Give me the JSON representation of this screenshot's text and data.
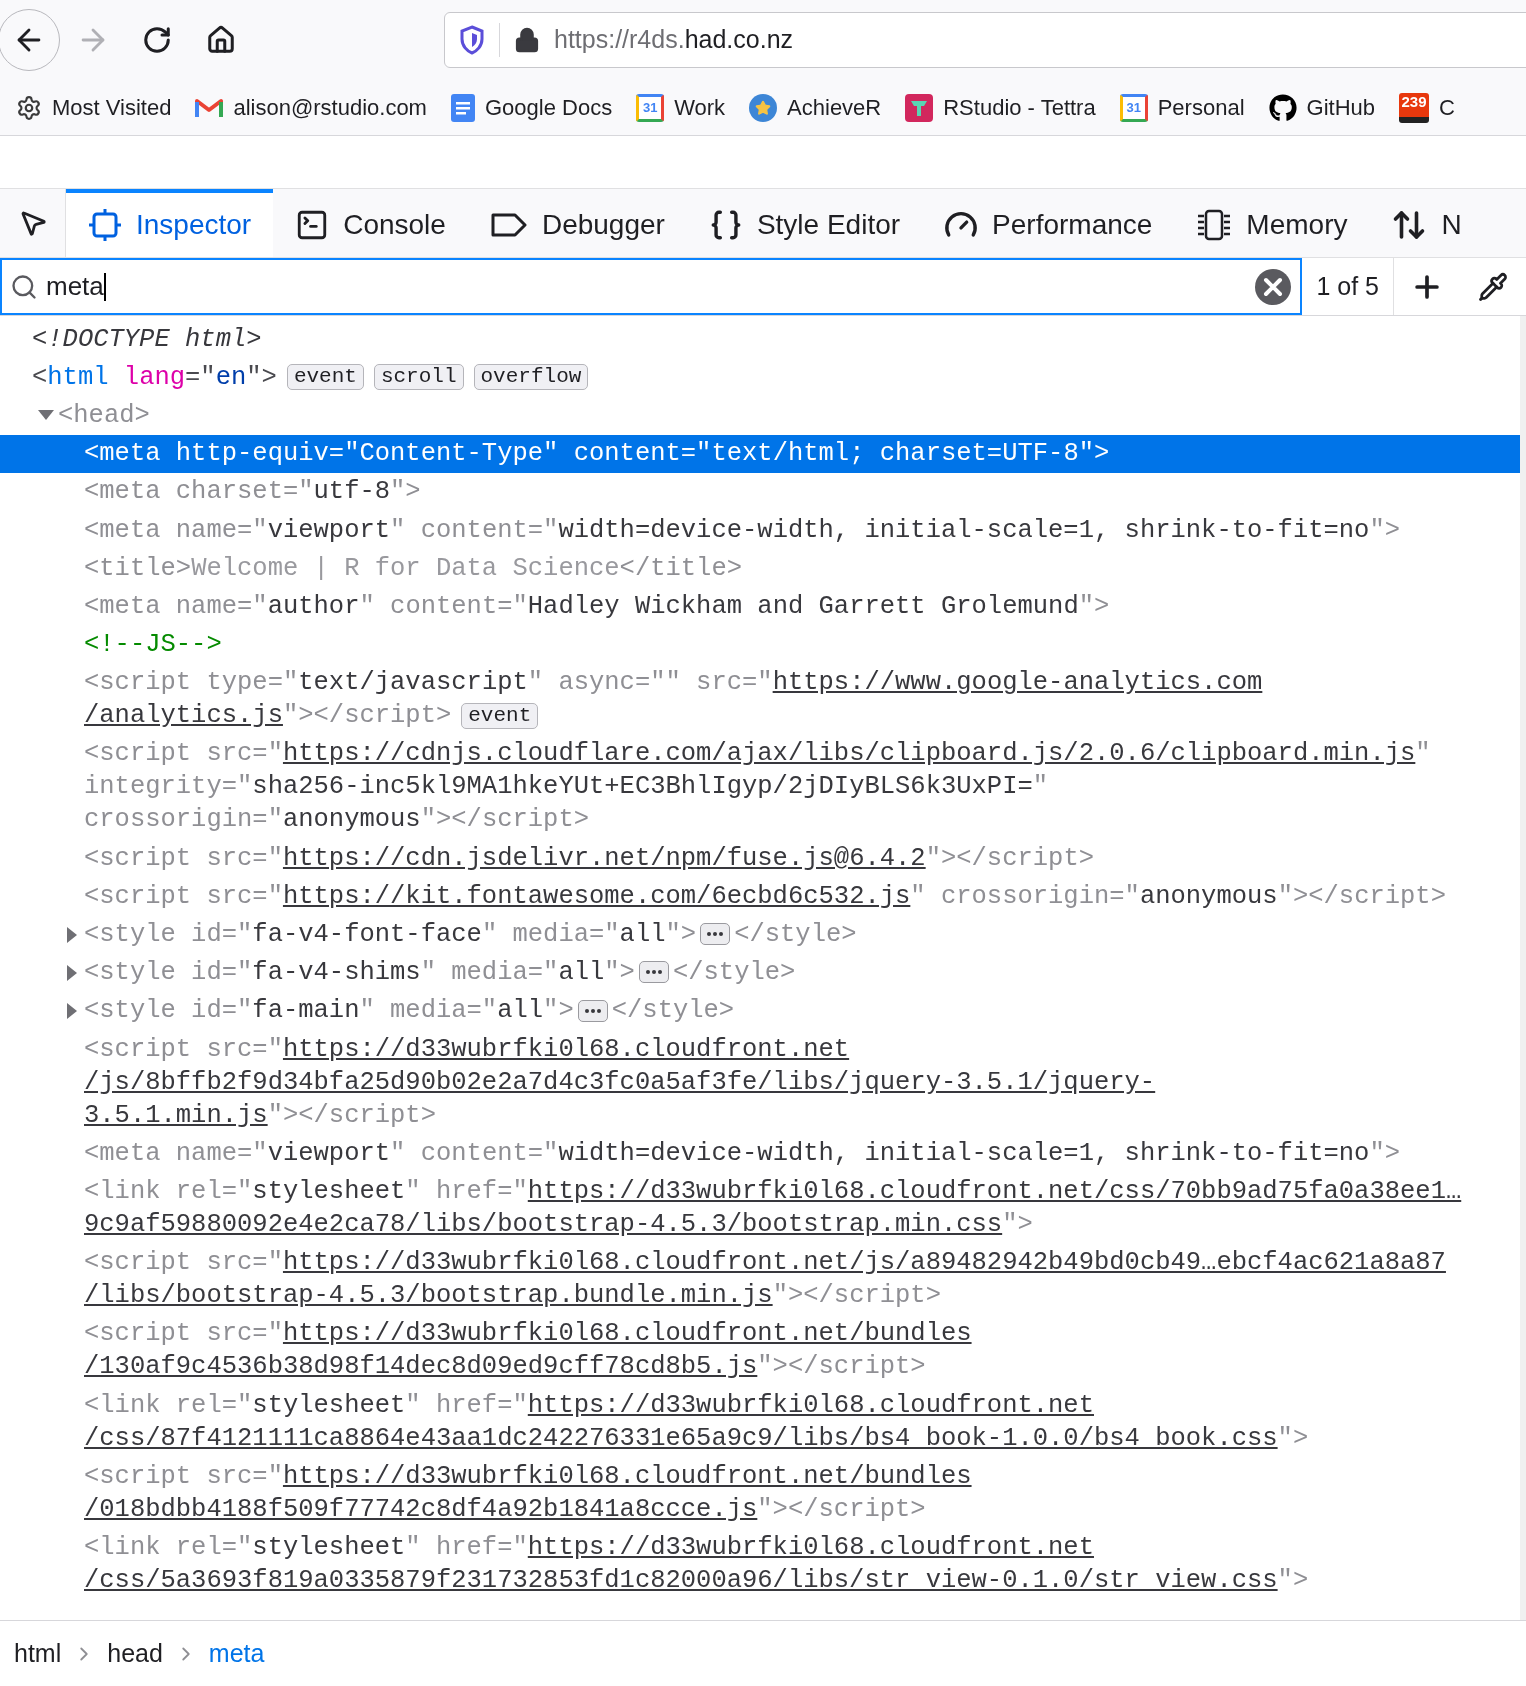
{
  "nav_buttons": [
    {
      "kind": "back",
      "disabled": false
    },
    {
      "kind": "forward",
      "disabled": true
    },
    {
      "kind": "reload",
      "disabled": false
    },
    {
      "kind": "home",
      "disabled": false
    }
  ],
  "url": {
    "prefix": "https://r4ds.",
    "host": "had.co.nz"
  },
  "bookmarks": [
    {
      "kind": "gear",
      "label": "Most Visited"
    },
    {
      "kind": "mail",
      "label": "alison@rstudio.com"
    },
    {
      "kind": "docs",
      "label": "Google Docs"
    },
    {
      "kind": "calendar",
      "icon_text": "31",
      "label": "Work"
    },
    {
      "kind": "star",
      "label": "AchieveR"
    },
    {
      "kind": "tettra",
      "label": "RStudio - Tettra"
    },
    {
      "kind": "calendar",
      "icon_text": "31",
      "label": "Personal"
    },
    {
      "kind": "github",
      "label": "GitHub"
    },
    {
      "kind": "counter",
      "icon_text": "239",
      "label": "C"
    }
  ],
  "devtools_tabs": [
    {
      "kind": "inspector",
      "label": "Inspector",
      "selected": true
    },
    {
      "kind": "console",
      "label": "Console",
      "selected": false
    },
    {
      "kind": "debugger",
      "label": "Debugger",
      "selected": false
    },
    {
      "kind": "style",
      "label": "Style Editor",
      "selected": false
    },
    {
      "kind": "performance",
      "label": "Performance",
      "selected": false
    },
    {
      "kind": "memory",
      "label": "Memory",
      "selected": false
    },
    {
      "kind": "network",
      "label": "N",
      "selected": false
    }
  ],
  "search": {
    "value": "meta",
    "match_count": "1 of 5"
  },
  "nodes": [
    {
      "selected": false,
      "lines": [
        [
          {
            "kind": "doctype",
            "text": "<!DOCTYPE html>"
          }
        ]
      ]
    },
    {
      "selected": false,
      "dimmed": false,
      "badges": [
        "event",
        "scroll",
        "overflow"
      ],
      "lines": [
        [
          {
            "kind": "punct",
            "text": "<"
          },
          {
            "kind": "tagname",
            "text": "html"
          },
          {
            "kind": "attr",
            "text": " lang"
          },
          {
            "kind": "punct",
            "text": "=\""
          },
          {
            "kind": "value",
            "text": "en"
          },
          {
            "kind": "punct",
            "text": "\">"
          }
        ]
      ],
      "children": [
        {
          "selected": false,
          "dimmed": true,
          "expanded": true,
          "lines": [
            [
              {
                "kind": "punct",
                "text": "<head>"
              }
            ]
          ],
          "children": [
            {
              "selected": true,
              "lines": [
                [
                  {
                    "kind": "punct",
                    "text": "<meta http-equiv=\""
                  },
                  {
                    "kind": "value",
                    "text": "Content-Type"
                  },
                  {
                    "kind": "punct",
                    "text": "\" content=\""
                  },
                  {
                    "kind": "value",
                    "text": "text/html; charset=UTF-8"
                  },
                  {
                    "kind": "punct",
                    "text": "\">"
                  }
                ]
              ]
            },
            {
              "selected": false,
              "lines": [
                [
                  {
                    "kind": "punct",
                    "text": "<meta charset=\""
                  },
                  {
                    "kind": "value",
                    "text": "utf-8"
                  },
                  {
                    "kind": "punct",
                    "text": "\">"
                  }
                ]
              ]
            },
            {
              "selected": false,
              "lines": [
                [
                  {
                    "kind": "punct",
                    "text": "<meta name=\""
                  },
                  {
                    "kind": "value",
                    "text": "viewport"
                  },
                  {
                    "kind": "punct",
                    "text": "\" content=\""
                  },
                  {
                    "kind": "value",
                    "text": "width=device-width, initial-scale=1, shrink-to-fit=no"
                  },
                  {
                    "kind": "punct",
                    "text": "\">"
                  }
                ]
              ]
            },
            {
              "selected": false,
              "lines": [
                [
                  {
                    "kind": "punct",
                    "text": "<title>"
                  },
                  {
                    "kind": "text",
                    "text": "Welcome | R for Data Science"
                  },
                  {
                    "kind": "punct",
                    "text": "</title>"
                  }
                ]
              ]
            },
            {
              "selected": false,
              "lines": [
                [
                  {
                    "kind": "punct",
                    "text": "<meta name=\""
                  },
                  {
                    "kind": "value",
                    "text": "author"
                  },
                  {
                    "kind": "punct",
                    "text": "\" content=\""
                  },
                  {
                    "kind": "value",
                    "text": "Hadley Wickham and Garrett Grolemund"
                  },
                  {
                    "kind": "punct",
                    "text": "\">"
                  }
                ]
              ]
            },
            {
              "selected": false,
              "lines": [
                [
                  {
                    "kind": "comment",
                    "text": "<!--JS-->"
                  }
                ]
              ]
            },
            {
              "selected": false,
              "badges": [
                "event"
              ],
              "lines": [
                [
                  {
                    "kind": "punct",
                    "text": "<script type=\""
                  },
                  {
                    "kind": "value",
                    "text": "text/javascript"
                  },
                  {
                    "kind": "punct",
                    "text": "\" async=\"\" src=\""
                  },
                  {
                    "kind": "link",
                    "text": "https://www.google-analytics.com"
                  }
                ],
                [
                  {
                    "kind": "link",
                    "text": "/analytics.js"
                  },
                  {
                    "kind": "punct",
                    "text": "\"></script>"
                  }
                ]
              ]
            },
            {
              "selected": false,
              "lines": [
                [
                  {
                    "kind": "punct",
                    "text": "<script src=\""
                  },
                  {
                    "kind": "link",
                    "text": "https://cdnjs.cloudflare.com/ajax/libs/clipboard.js/2.0.6/clipboard.min.js"
                  },
                  {
                    "kind": "punct",
                    "text": "\""
                  }
                ],
                [
                  {
                    "kind": "punct",
                    "text": "integrity=\""
                  },
                  {
                    "kind": "value",
                    "text": "sha256-inc5kl9MA1hkeYUt+EC3BhlIgyp/2jDIyBLS6k3UxPI="
                  },
                  {
                    "kind": "punct",
                    "text": "\""
                  }
                ],
                [
                  {
                    "kind": "punct",
                    "text": "crossorigin=\""
                  },
                  {
                    "kind": "value",
                    "text": "anonymous"
                  },
                  {
                    "kind": "punct",
                    "text": "\"></script>"
                  }
                ]
              ]
            },
            {
              "selected": false,
              "lines": [
                [
                  {
                    "kind": "punct",
                    "text": "<script src=\""
                  },
                  {
                    "kind": "link",
                    "text": "https://cdn.jsdelivr.net/npm/fuse.js@6.4.2"
                  },
                  {
                    "kind": "punct",
                    "text": "\"></script>"
                  }
                ]
              ]
            },
            {
              "selected": false,
              "lines": [
                [
                  {
                    "kind": "punct",
                    "text": "<script src=\""
                  },
                  {
                    "kind": "link",
                    "text": "https://kit.fontawesome.com/6ecbd6c532.js"
                  },
                  {
                    "kind": "punct",
                    "text": "\" crossorigin=\""
                  },
                  {
                    "kind": "value",
                    "text": "anonymous"
                  },
                  {
                    "kind": "punct",
                    "text": "\"></script>"
                  }
                ]
              ]
            },
            {
              "selected": false,
              "expanded": false,
              "lines": [
                [
                  {
                    "kind": "punct",
                    "text": "<style id=\""
                  },
                  {
                    "kind": "value",
                    "text": "fa-v4-font-face"
                  },
                  {
                    "kind": "punct",
                    "text": "\" media=\""
                  },
                  {
                    "kind": "value",
                    "text": "all"
                  },
                  {
                    "kind": "punct",
                    "text": "\">"
                  },
                  {
                    "kind": "more"
                  },
                  {
                    "kind": "punct",
                    "text": "</style>"
                  }
                ]
              ]
            },
            {
              "selected": false,
              "expanded": false,
              "lines": [
                [
                  {
                    "kind": "punct",
                    "text": "<style id=\""
                  },
                  {
                    "kind": "value",
                    "text": "fa-v4-shims"
                  },
                  {
                    "kind": "punct",
                    "text": "\" media=\""
                  },
                  {
                    "kind": "value",
                    "text": "all"
                  },
                  {
                    "kind": "punct",
                    "text": "\">"
                  },
                  {
                    "kind": "more"
                  },
                  {
                    "kind": "punct",
                    "text": "</style>"
                  }
                ]
              ]
            },
            {
              "selected": false,
              "expanded": false,
              "lines": [
                [
                  {
                    "kind": "punct",
                    "text": "<style id=\""
                  },
                  {
                    "kind": "value",
                    "text": "fa-main"
                  },
                  {
                    "kind": "punct",
                    "text": "\" media=\""
                  },
                  {
                    "kind": "value",
                    "text": "all"
                  },
                  {
                    "kind": "punct",
                    "text": "\">"
                  },
                  {
                    "kind": "more"
                  },
                  {
                    "kind": "punct",
                    "text": "</style>"
                  }
                ]
              ]
            },
            {
              "selected": false,
              "lines": [
                [
                  {
                    "kind": "punct",
                    "text": "<script src=\""
                  },
                  {
                    "kind": "link",
                    "text": "https://d33wubrfki0l68.cloudfront.net"
                  }
                ],
                [
                  {
                    "kind": "link",
                    "text": "/js/8bffb2f9d34bfa25d90b02e2a7d4c3fc0a5af3fe/libs/jquery-3.5.1/jquery-"
                  }
                ],
                [
                  {
                    "kind": "link",
                    "text": "3.5.1.min.js"
                  },
                  {
                    "kind": "punct",
                    "text": "\"></script>"
                  }
                ]
              ]
            },
            {
              "selected": false,
              "lines": [
                [
                  {
                    "kind": "punct",
                    "text": "<meta name=\""
                  },
                  {
                    "kind": "value",
                    "text": "viewport"
                  },
                  {
                    "kind": "punct",
                    "text": "\" content=\""
                  },
                  {
                    "kind": "value",
                    "text": "width=device-width, initial-scale=1, shrink-to-fit=no"
                  },
                  {
                    "kind": "punct",
                    "text": "\">"
                  }
                ]
              ]
            },
            {
              "selected": false,
              "lines": [
                [
                  {
                    "kind": "punct",
                    "text": "<link rel=\""
                  },
                  {
                    "kind": "value",
                    "text": "stylesheet"
                  },
                  {
                    "kind": "punct",
                    "text": "\" href=\""
                  },
                  {
                    "kind": "link",
                    "text": "https://d33wubrfki0l68.cloudfront.net/css/70bb9ad75fa0a38ee1…"
                  }
                ],
                [
                  {
                    "kind": "link",
                    "text": "9c9af59880092e4e2ca78/libs/bootstrap-4.5.3/bootstrap.min.css"
                  },
                  {
                    "kind": "punct",
                    "text": "\">"
                  }
                ]
              ]
            },
            {
              "selected": false,
              "lines": [
                [
                  {
                    "kind": "punct",
                    "text": "<script src=\""
                  },
                  {
                    "kind": "link",
                    "text": "https://d33wubrfki0l68.cloudfront.net/js/a89482942b49bd0cb49…ebcf4ac621a8a87"
                  }
                ],
                [
                  {
                    "kind": "link",
                    "text": "/libs/bootstrap-4.5.3/bootstrap.bundle.min.js"
                  },
                  {
                    "kind": "punct",
                    "text": "\"></script>"
                  }
                ]
              ]
            },
            {
              "selected": false,
              "lines": [
                [
                  {
                    "kind": "punct",
                    "text": "<script src=\""
                  },
                  {
                    "kind": "link",
                    "text": "https://d33wubrfki0l68.cloudfront.net/bundles"
                  }
                ],
                [
                  {
                    "kind": "link",
                    "text": "/130af9c4536b38d98f14dec8d09ed9cff78cd8b5.js"
                  },
                  {
                    "kind": "punct",
                    "text": "\"></script>"
                  }
                ]
              ]
            },
            {
              "selected": false,
              "lines": [
                [
                  {
                    "kind": "punct",
                    "text": "<link rel=\""
                  },
                  {
                    "kind": "value",
                    "text": "stylesheet"
                  },
                  {
                    "kind": "punct",
                    "text": "\" href=\""
                  },
                  {
                    "kind": "link",
                    "text": "https://d33wubrfki0l68.cloudfront.net"
                  }
                ],
                [
                  {
                    "kind": "link",
                    "text": "/css/87f4121111ca8864e43aa1dc242276331e65a9c9/libs/bs4_book-1.0.0/bs4_book.css"
                  },
                  {
                    "kind": "punct",
                    "text": "\">"
                  }
                ]
              ]
            },
            {
              "selected": false,
              "lines": [
                [
                  {
                    "kind": "punct",
                    "text": "<script src=\""
                  },
                  {
                    "kind": "link",
                    "text": "https://d33wubrfki0l68.cloudfront.net/bundles"
                  }
                ],
                [
                  {
                    "kind": "link",
                    "text": "/018bdbb4188f509f77742c8df4a92b1841a8ccce.js"
                  },
                  {
                    "kind": "punct",
                    "text": "\"></script>"
                  }
                ]
              ]
            },
            {
              "selected": false,
              "lines": [
                [
                  {
                    "kind": "punct",
                    "text": "<link rel=\""
                  },
                  {
                    "kind": "value",
                    "text": "stylesheet"
                  },
                  {
                    "kind": "punct",
                    "text": "\" href=\""
                  },
                  {
                    "kind": "link",
                    "text": "https://d33wubrfki0l68.cloudfront.net"
                  }
                ],
                [
                  {
                    "kind": "link",
                    "text": "/css/5a3693f819a0335879f231732853fd1c82000a96/libs/str_view-0.1.0/str_view.css"
                  },
                  {
                    "kind": "punct",
                    "text": "\">"
                  }
                ]
              ]
            }
          ]
        }
      ]
    }
  ],
  "breadcrumbs": [
    {
      "label": "html",
      "selected": false
    },
    {
      "label": "head",
      "selected": false
    },
    {
      "label": "meta",
      "selected": true
    }
  ]
}
